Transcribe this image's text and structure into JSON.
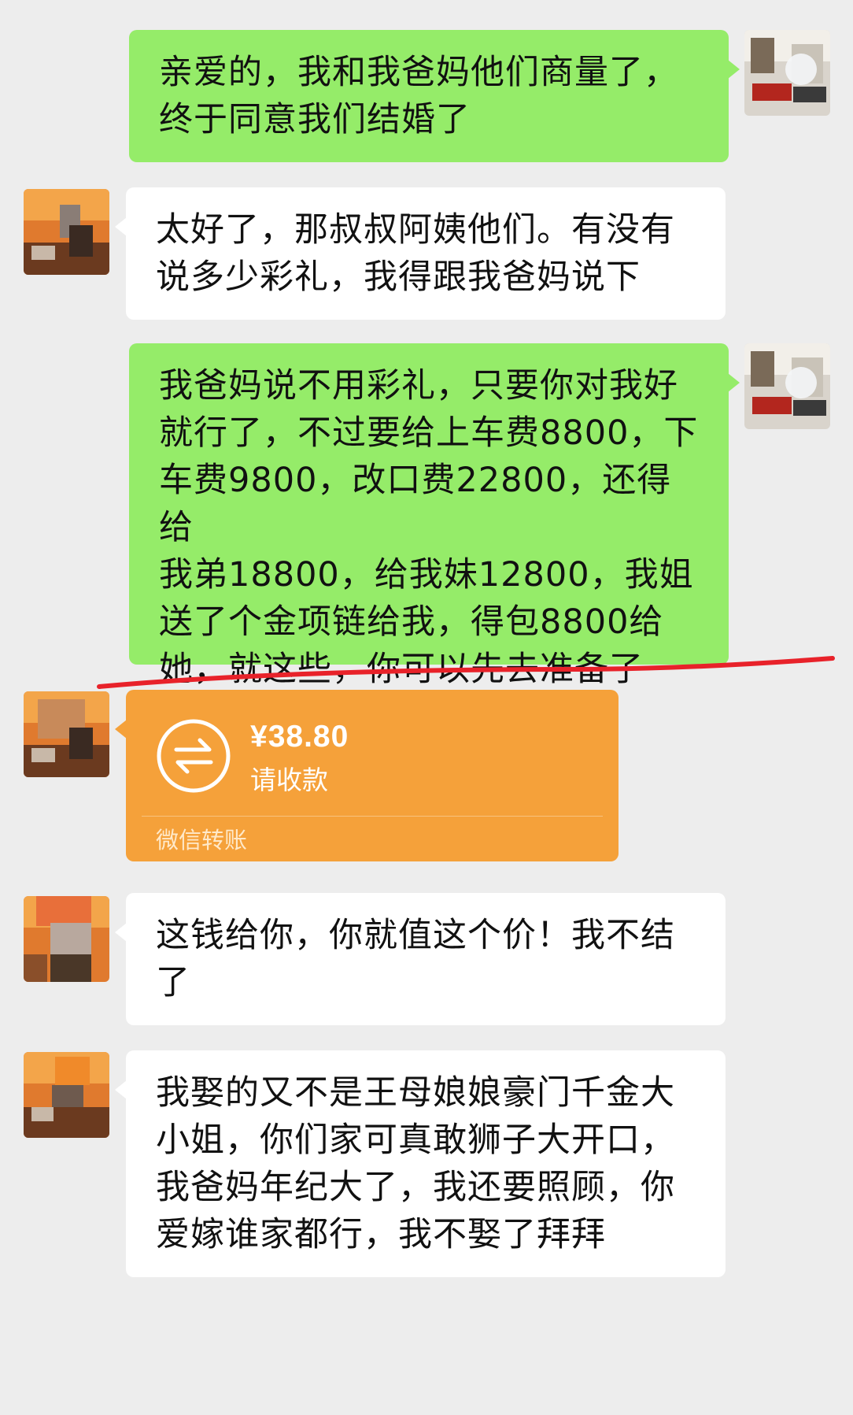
{
  "messages": {
    "m1": "亲爱的，我和我爸妈他们商量了，\n终于同意我们结婚了",
    "m2": "太好了，那叔叔阿姨他们。有没有\n说多少彩礼，我得跟我爸妈说下",
    "m3": "我爸妈说不用彩礼，只要你对我好\n就行了，不过要给上车费8800，下\n车费9800，改口费22800，还得给\n我弟18800，给我妹12800，我姐\n送了个金项链给我，得包8800给\n她，就这些，你可以先去准备了",
    "m5": "这钱给你，你就值这个价！我不结\n了",
    "m6": "我娶的又不是王母娘娘豪门千金大\n小姐，你们家可真敢狮子大开口，\n我爸妈年纪大了，我还要照顾，你\n爱嫁谁家都行，我不娶了拜拜"
  },
  "transfer": {
    "amount": "¥38.80",
    "status": "请收款",
    "footer": "微信转账",
    "icon": "transfer-arrows-icon"
  },
  "colors": {
    "background": "#ededed",
    "outgoing_bubble": "#95ec69",
    "incoming_bubble": "#ffffff",
    "transfer_card": "#f5a13a",
    "annotation_line": "#e8222a"
  }
}
